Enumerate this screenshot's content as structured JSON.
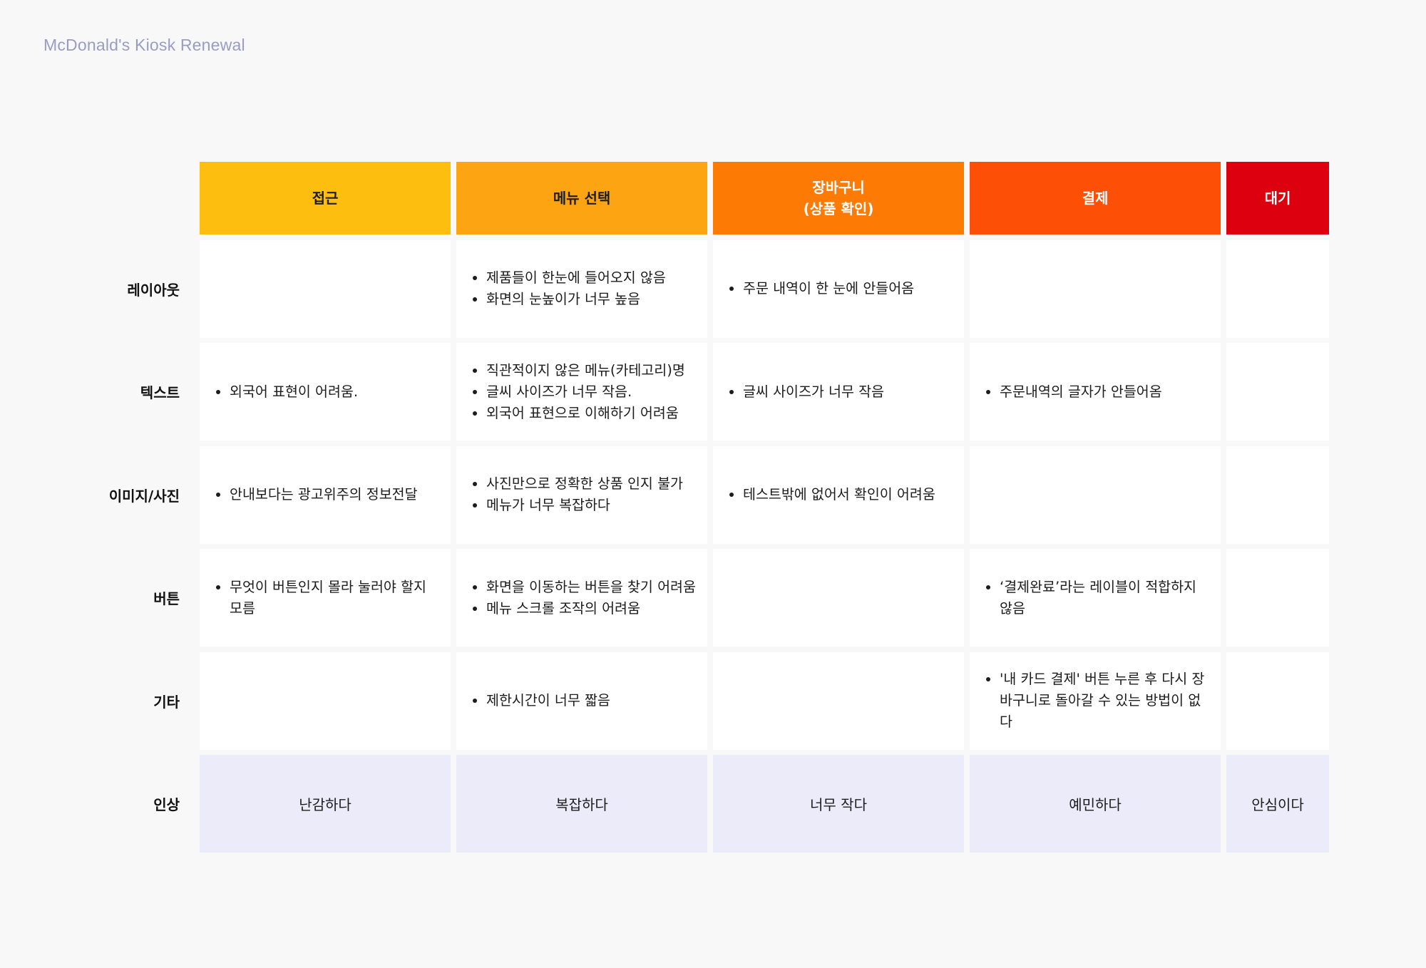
{
  "page_title": "McDonald's Kiosk Renewal",
  "stages": [
    {
      "label": "접근",
      "color": "#fdbe10"
    },
    {
      "label": "메뉴 선택",
      "color": "#fda413"
    },
    {
      "label": "장바구니\n(상품 확인)",
      "color": "#fd7b05"
    },
    {
      "label": "결제",
      "color": "#fd4f06"
    },
    {
      "label": "대기",
      "color": "#dd0110"
    }
  ],
  "rows": [
    {
      "label": "레이아웃",
      "cells": [
        [],
        [
          "제품들이 한눈에 들어오지 않음",
          "화면의 눈높이가 너무 높음"
        ],
        [
          "주문 내역이 한 눈에 안들어옴"
        ],
        [],
        []
      ]
    },
    {
      "label": "텍스트",
      "cells": [
        [
          "외국어 표현이 어려움."
        ],
        [
          "직관적이지 않은 메뉴(카테고리)명",
          "글씨 사이즈가 너무 작음.",
          "외국어 표현으로 이해하기 어려움"
        ],
        [
          "글씨 사이즈가 너무 작음"
        ],
        [
          "주문내역의 글자가 안들어옴"
        ],
        []
      ]
    },
    {
      "label": "이미지/사진",
      "cells": [
        [
          "안내보다는 광고위주의 정보전달"
        ],
        [
          "사진만으로 정확한 상품 인지 불가",
          "메뉴가 너무 복잡하다"
        ],
        [
          "테스트밖에 없어서 확인이 어려움"
        ],
        [],
        []
      ]
    },
    {
      "label": "버튼",
      "cells": [
        [
          "무엇이 버튼인지 몰라 눌러야 할지 모름"
        ],
        [
          "화면을 이동하는 버튼을 찾기 어려움",
          "메뉴 스크롤 조작의 어려움"
        ],
        [],
        [
          "‘결제완료’라는 레이블이 적합하지 않음"
        ],
        []
      ]
    },
    {
      "label": "기타",
      "cells": [
        [],
        [
          "제한시간이 너무 짧음"
        ],
        [],
        [
          "'내 카드 결제' 버튼 누른 후 다시 장바구니로 돌아갈 수 있는 방법이 없다"
        ],
        []
      ]
    }
  ],
  "impression": {
    "label": "인상",
    "values": [
      "난감하다",
      "복잡하다",
      "너무 작다",
      "예민하다",
      "안심이다"
    ]
  }
}
